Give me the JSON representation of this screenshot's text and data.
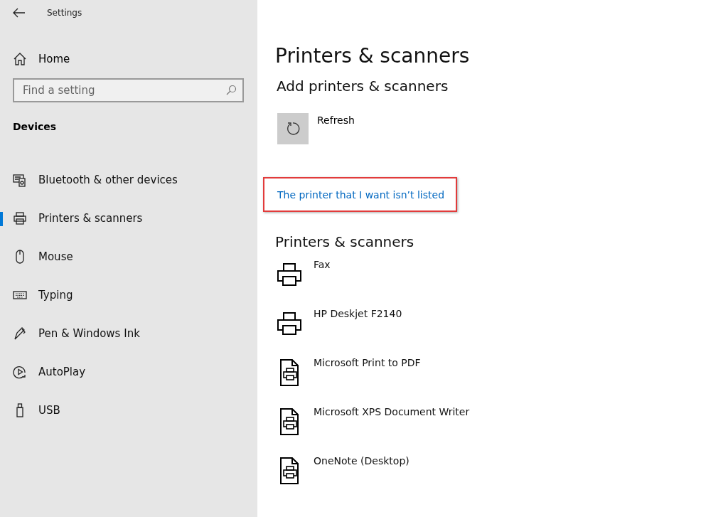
{
  "window": {
    "title": "Settings"
  },
  "sidebar": {
    "home": "Home",
    "search": {
      "placeholder": "Find a setting"
    },
    "section": "Devices",
    "items": [
      {
        "label": "Bluetooth & other devices",
        "kind": "bluetooth",
        "selected": false
      },
      {
        "label": "Printers & scanners",
        "kind": "printer",
        "selected": true
      },
      {
        "label": "Mouse",
        "kind": "mouse",
        "selected": false
      },
      {
        "label": "Typing",
        "kind": "keyboard",
        "selected": false
      },
      {
        "label": "Pen & Windows Ink",
        "kind": "pen",
        "selected": false
      },
      {
        "label": "AutoPlay",
        "kind": "autoplay",
        "selected": false
      },
      {
        "label": "USB",
        "kind": "usb",
        "selected": false
      }
    ]
  },
  "main": {
    "title": "Printers & scanners",
    "add_heading": "Add printers & scanners",
    "refresh": "Refresh",
    "link": {
      "text": "The printer that I want isn’t listed",
      "highlighted": true
    },
    "list_heading": "Printers & scanners",
    "printers": [
      {
        "name": "Fax",
        "kind": "printer"
      },
      {
        "name": "HP Deskjet F2140",
        "kind": "printer"
      },
      {
        "name": "Microsoft Print to PDF",
        "kind": "document"
      },
      {
        "name": "Microsoft XPS Document Writer",
        "kind": "document"
      },
      {
        "name": "OneNote (Desktop)",
        "kind": "document"
      }
    ]
  }
}
